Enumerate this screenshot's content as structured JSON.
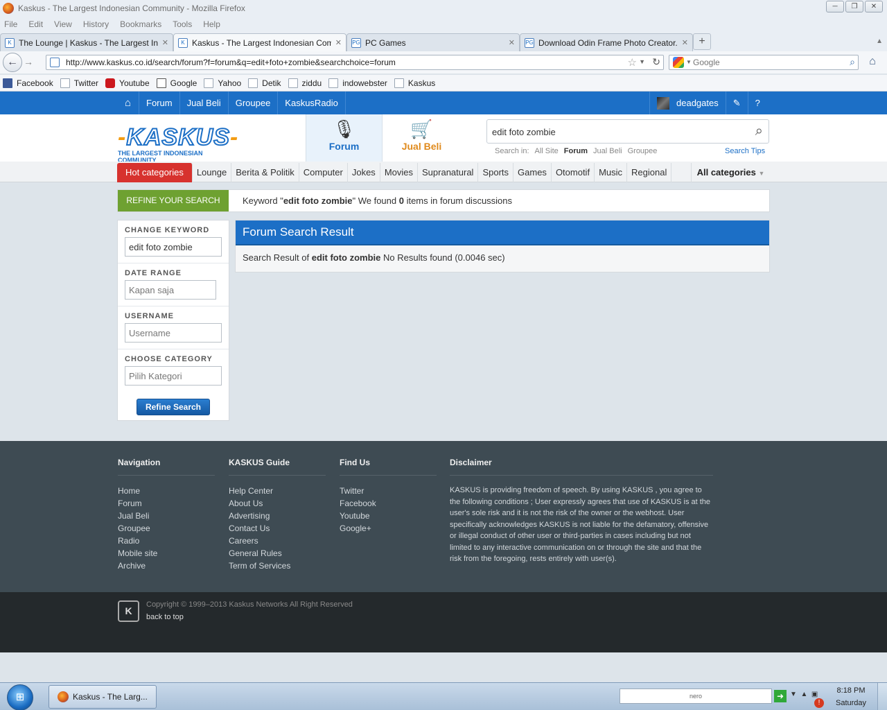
{
  "window": {
    "title": "Kaskus - The Largest Indonesian Community - Mozilla Firefox",
    "controls": [
      "─",
      "❐",
      "✕"
    ]
  },
  "menu": [
    "File",
    "Edit",
    "View",
    "History",
    "Bookmarks",
    "Tools",
    "Help"
  ],
  "tabs": [
    {
      "label": "The Lounge | Kaskus - The Largest In...",
      "fav": "K"
    },
    {
      "label": "Kaskus - The Largest Indonesian Comm...",
      "fav": "K"
    },
    {
      "label": "PC Games",
      "fav": "PG"
    },
    {
      "label": "Download Odin Frame Photo Creator...",
      "fav": "PG"
    }
  ],
  "newtab_label": "+",
  "nav": {
    "url": "http://www.kaskus.co.id/search/forum?f=forum&q=edit+foto+zombie&searchchoice=forum",
    "search_placeholder": "Google"
  },
  "bookmarks": [
    "Facebook",
    "Twitter",
    "Youtube",
    "Google",
    "Yahoo",
    "Detik",
    "ziddu",
    "indowebster",
    "Kaskus"
  ],
  "site": {
    "topnav": [
      "Forum",
      "Jual Beli",
      "Groupee",
      "KaskusRadio"
    ],
    "username": "deadgates",
    "logo_word": "KASKUS",
    "logo_tagline": "THE LARGEST INDONESIAN COMMUNITY",
    "tab_forum": "Forum",
    "tab_jualbeli": "Jual Beli",
    "search_value": "edit foto zombie",
    "search_in_label": "Search in:",
    "search_in": [
      "All Site",
      "Forum",
      "Jual Beli",
      "Groupee"
    ],
    "search_tips": "Search Tips",
    "hot_categories": "Hot categories",
    "categories": [
      "Lounge",
      "Berita & Politik",
      "Computer",
      "Jokes",
      "Movies",
      "Supranatural",
      "Sports",
      "Games",
      "Otomotif",
      "Music",
      "Regional"
    ],
    "all_categories": "All categories",
    "refine_label": "REFINE YOUR SEARCH",
    "keyword_prefix": "Keyword \"",
    "keyword": "edit foto zombie",
    "keyword_mid": "\" We found ",
    "found_count": "0",
    "keyword_suffix": " items in forum discussions",
    "sidebar": {
      "change_keyword_label": "CHANGE KEYWORD",
      "change_keyword_value": "edit foto zombie",
      "date_range_label": "DATE RANGE",
      "date_range_placeholder": "Kapan saja",
      "username_label": "USERNAME",
      "username_placeholder": "Username",
      "category_label": "CHOOSE CATEGORY",
      "category_placeholder": "Pilih Kategori",
      "refine_button": "Refine Search"
    },
    "result": {
      "heading": "Forum Search Result",
      "prefix": "Search Result of ",
      "keyword": "edit foto zombie",
      "suffix": " No Results found (0.0046 sec)"
    },
    "footer": {
      "navigation": {
        "title": "Navigation",
        "links": [
          "Home",
          "Forum",
          "Jual Beli",
          "Groupee",
          "Radio",
          "Mobile site",
          "Archive"
        ]
      },
      "guide": {
        "title": "KASKUS Guide",
        "links": [
          "Help Center",
          "About Us",
          "Advertising",
          "Contact Us",
          "Careers",
          "General Rules",
          "Term of Services"
        ]
      },
      "findus": {
        "title": "Find Us",
        "links": [
          "Twitter",
          "Facebook",
          "Youtube",
          "Google+"
        ]
      },
      "disclaimer": {
        "title": "Disclaimer",
        "text": "KASKUS is providing freedom of speech. By using KASKUS , you agree to the following conditions ; User expressly agrees that use of KASKUS is at the user's sole risk and it is not the risk of the owner or the webhost. User specifically acknowledges KASKUS is not liable for the defamatory, offensive or illegal conduct of other user or third-parties in cases including but not limited to any interactive communication on or through the site and that the risk from the foregoing, rests entirely with user(s)."
      },
      "copyright": "Copyright © 1999–2013 Kaskus Networks All Right Reserved",
      "back_to_top": "back to top"
    }
  },
  "taskbar": {
    "task_label": "Kaskus - The Larg...",
    "nero": "nero",
    "time": "8:18 PM",
    "day": "Saturday"
  },
  "colors": {
    "kaskus_blue": "#1c6fc6",
    "refine_green": "#6ea131",
    "hot_red": "#d7322e",
    "footer_bg": "#3e4b53"
  }
}
